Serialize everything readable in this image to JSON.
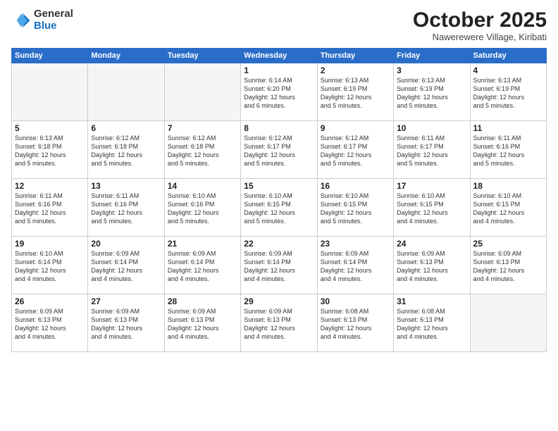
{
  "logo": {
    "general": "General",
    "blue": "Blue"
  },
  "header": {
    "title": "October 2025",
    "subtitle": "Nawerewere Village, Kiribati"
  },
  "weekdays": [
    "Sunday",
    "Monday",
    "Tuesday",
    "Wednesday",
    "Thursday",
    "Friday",
    "Saturday"
  ],
  "weeks": [
    [
      {
        "day": "",
        "info": ""
      },
      {
        "day": "",
        "info": ""
      },
      {
        "day": "",
        "info": ""
      },
      {
        "day": "1",
        "info": "Sunrise: 6:14 AM\nSunset: 6:20 PM\nDaylight: 12 hours\nand 6 minutes."
      },
      {
        "day": "2",
        "info": "Sunrise: 6:13 AM\nSunset: 6:19 PM\nDaylight: 12 hours\nand 5 minutes."
      },
      {
        "day": "3",
        "info": "Sunrise: 6:13 AM\nSunset: 6:19 PM\nDaylight: 12 hours\nand 5 minutes."
      },
      {
        "day": "4",
        "info": "Sunrise: 6:13 AM\nSunset: 6:19 PM\nDaylight: 12 hours\nand 5 minutes."
      }
    ],
    [
      {
        "day": "5",
        "info": "Sunrise: 6:13 AM\nSunset: 6:18 PM\nDaylight: 12 hours\nand 5 minutes."
      },
      {
        "day": "6",
        "info": "Sunrise: 6:12 AM\nSunset: 6:18 PM\nDaylight: 12 hours\nand 5 minutes."
      },
      {
        "day": "7",
        "info": "Sunrise: 6:12 AM\nSunset: 6:18 PM\nDaylight: 12 hours\nand 5 minutes."
      },
      {
        "day": "8",
        "info": "Sunrise: 6:12 AM\nSunset: 6:17 PM\nDaylight: 12 hours\nand 5 minutes."
      },
      {
        "day": "9",
        "info": "Sunrise: 6:12 AM\nSunset: 6:17 PM\nDaylight: 12 hours\nand 5 minutes."
      },
      {
        "day": "10",
        "info": "Sunrise: 6:11 AM\nSunset: 6:17 PM\nDaylight: 12 hours\nand 5 minutes."
      },
      {
        "day": "11",
        "info": "Sunrise: 6:11 AM\nSunset: 6:16 PM\nDaylight: 12 hours\nand 5 minutes."
      }
    ],
    [
      {
        "day": "12",
        "info": "Sunrise: 6:11 AM\nSunset: 6:16 PM\nDaylight: 12 hours\nand 5 minutes."
      },
      {
        "day": "13",
        "info": "Sunrise: 6:11 AM\nSunset: 6:16 PM\nDaylight: 12 hours\nand 5 minutes."
      },
      {
        "day": "14",
        "info": "Sunrise: 6:10 AM\nSunset: 6:16 PM\nDaylight: 12 hours\nand 5 minutes."
      },
      {
        "day": "15",
        "info": "Sunrise: 6:10 AM\nSunset: 6:15 PM\nDaylight: 12 hours\nand 5 minutes."
      },
      {
        "day": "16",
        "info": "Sunrise: 6:10 AM\nSunset: 6:15 PM\nDaylight: 12 hours\nand 5 minutes."
      },
      {
        "day": "17",
        "info": "Sunrise: 6:10 AM\nSunset: 6:15 PM\nDaylight: 12 hours\nand 4 minutes."
      },
      {
        "day": "18",
        "info": "Sunrise: 6:10 AM\nSunset: 6:15 PM\nDaylight: 12 hours\nand 4 minutes."
      }
    ],
    [
      {
        "day": "19",
        "info": "Sunrise: 6:10 AM\nSunset: 6:14 PM\nDaylight: 12 hours\nand 4 minutes."
      },
      {
        "day": "20",
        "info": "Sunrise: 6:09 AM\nSunset: 6:14 PM\nDaylight: 12 hours\nand 4 minutes."
      },
      {
        "day": "21",
        "info": "Sunrise: 6:09 AM\nSunset: 6:14 PM\nDaylight: 12 hours\nand 4 minutes."
      },
      {
        "day": "22",
        "info": "Sunrise: 6:09 AM\nSunset: 6:14 PM\nDaylight: 12 hours\nand 4 minutes."
      },
      {
        "day": "23",
        "info": "Sunrise: 6:09 AM\nSunset: 6:14 PM\nDaylight: 12 hours\nand 4 minutes."
      },
      {
        "day": "24",
        "info": "Sunrise: 6:09 AM\nSunset: 6:13 PM\nDaylight: 12 hours\nand 4 minutes."
      },
      {
        "day": "25",
        "info": "Sunrise: 6:09 AM\nSunset: 6:13 PM\nDaylight: 12 hours\nand 4 minutes."
      }
    ],
    [
      {
        "day": "26",
        "info": "Sunrise: 6:09 AM\nSunset: 6:13 PM\nDaylight: 12 hours\nand 4 minutes."
      },
      {
        "day": "27",
        "info": "Sunrise: 6:09 AM\nSunset: 6:13 PM\nDaylight: 12 hours\nand 4 minutes."
      },
      {
        "day": "28",
        "info": "Sunrise: 6:09 AM\nSunset: 6:13 PM\nDaylight: 12 hours\nand 4 minutes."
      },
      {
        "day": "29",
        "info": "Sunrise: 6:09 AM\nSunset: 6:13 PM\nDaylight: 12 hours\nand 4 minutes."
      },
      {
        "day": "30",
        "info": "Sunrise: 6:08 AM\nSunset: 6:13 PM\nDaylight: 12 hours\nand 4 minutes."
      },
      {
        "day": "31",
        "info": "Sunrise: 6:08 AM\nSunset: 6:13 PM\nDaylight: 12 hours\nand 4 minutes."
      },
      {
        "day": "",
        "info": ""
      }
    ]
  ]
}
